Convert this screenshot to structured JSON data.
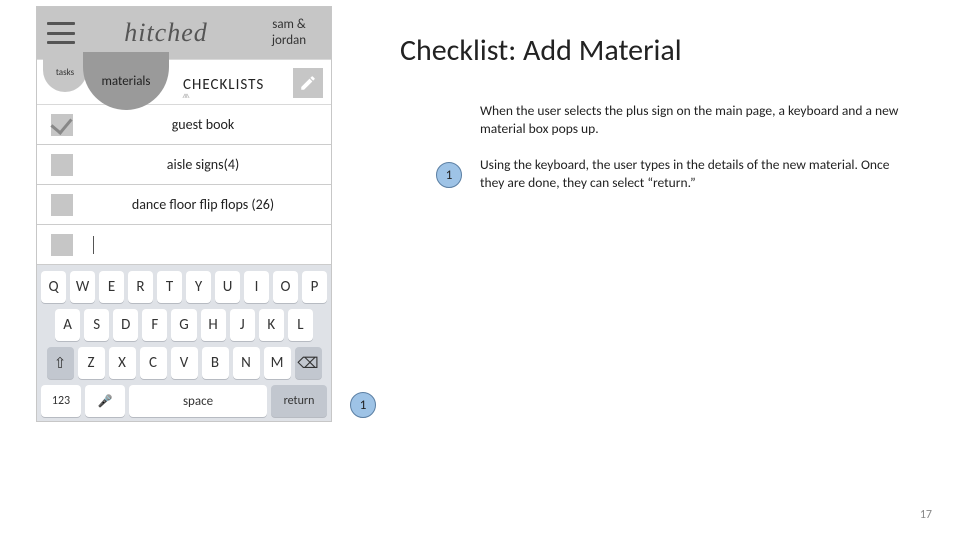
{
  "page_number": "17",
  "doc": {
    "title": "Checklist: Add Material",
    "p1": "When the user selects the plus sign on the main page, a keyboard and a new material box pops up.",
    "p2": "Using the keyboard, the user types in the details of the new material. Once they are done, they can select “return.”",
    "badge1": "1",
    "badge2": "1"
  },
  "phone": {
    "brand": "hitched",
    "names_line1": "sam &",
    "names_line2": "jordan",
    "tab_tasks": "tasks",
    "tab_materials": "materials",
    "subhead": "CHECKLISTS",
    "rows": [
      {
        "label": "guest book",
        "checked": true
      },
      {
        "label": "aisle signs(4)",
        "checked": false
      },
      {
        "label": "dance floor flip flops (26)",
        "checked": false
      }
    ],
    "new_input": ""
  },
  "keyboard": {
    "row1": [
      "Q",
      "W",
      "E",
      "R",
      "T",
      "Y",
      "U",
      "I",
      "O",
      "P"
    ],
    "row2": [
      "A",
      "S",
      "D",
      "F",
      "G",
      "H",
      "J",
      "K",
      "L"
    ],
    "row3": [
      "Z",
      "X",
      "C",
      "V",
      "B",
      "N",
      "M"
    ],
    "shift_icon": "⇧",
    "backspace_icon": "⌫",
    "numkey": "123",
    "mic_icon": "🎤",
    "space": "space",
    "return": "return"
  }
}
